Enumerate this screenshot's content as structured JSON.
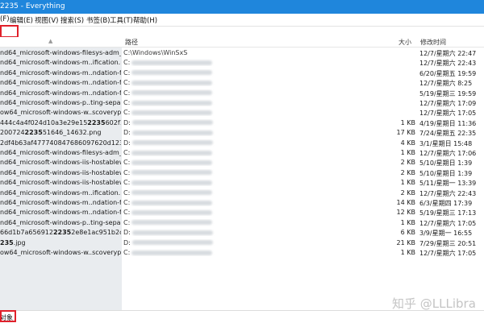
{
  "window": {
    "title": "2235 - Everything"
  },
  "menu": [
    "(F)",
    "编辑(E)",
    "视图(V)",
    "搜索(S)",
    "书签(B)",
    "工具(T)",
    "帮助(H)"
  ],
  "search": {
    "value": ""
  },
  "columns": {
    "name": "",
    "path": "路径",
    "size": "大小",
    "modified": "修改时间"
  },
  "rows": [
    {
      "name": "nd64_microsoft-windows-filesys-adm_31...",
      "path": "C:\\Windows\\WinSxS",
      "size": "",
      "modified": "12/7/星期六 22:47"
    },
    {
      "name": "nd64_microsoft-windows-m..ification.reso...",
      "path": "C:",
      "size": "",
      "modified": "12/7/星期六 22:43"
    },
    {
      "name": "nd64_microsoft-windows-m..ndation-fra...",
      "path": "C:",
      "size": "",
      "modified": "6/20/星期五 19:59"
    },
    {
      "name": "nd64_microsoft-windows-m..ndation-fra...",
      "path": "C:",
      "size": "",
      "modified": "12/7/星期六 8:25"
    },
    {
      "name": "nd64_microsoft-windows-m..ndation-fra...",
      "path": "C:",
      "size": "",
      "modified": "5/19/星期三 19:59"
    },
    {
      "name": "nd64_microsoft-windows-p..ting-separat...",
      "path": "C:",
      "size": "",
      "modified": "12/7/星期六 17:09"
    },
    {
      "name": "ow64_microsoft-windows-w..scoverypro...",
      "path": "C:",
      "size": "",
      "modified": "12/7/星期六 17:05"
    },
    {
      "name": "444c4a4f024d10a3e29e15",
      "bold": "2235",
      "tail": "602f180...",
      "path": "D:",
      "size": "1 KB",
      "modified": "4/19/星期日 11:36"
    },
    {
      "name": "200724",
      "bold": "2235",
      "tail": "51646_14632.png",
      "path": "D:",
      "size": "17 KB",
      "modified": "7/24/星期五 22:35"
    },
    {
      "name": "2df4b63af477740847686097620d1235...",
      "path": "D:",
      "size": "4 KB",
      "modified": "3/1/星期日 15:48"
    },
    {
      "name": "nd64_microsoft-windows-filesys-adm_31...",
      "path": "C:",
      "size": "1 KB",
      "modified": "12/7/星期六 17:06"
    },
    {
      "name": "nd64_microsoft-windows-iis-hostablewe...",
      "path": "C:",
      "size": "2 KB",
      "modified": "5/10/星期日 1:39"
    },
    {
      "name": "nd64_microsoft-windows-iis-hostablewe...",
      "path": "C:",
      "size": "2 KB",
      "modified": "5/10/星期日 1:39"
    },
    {
      "name": "nd64_microsoft-windows-iis-hostablewe...",
      "path": "C:",
      "size": "1 KB",
      "modified": "5/11/星期一 13:39"
    },
    {
      "name": "nd64_microsoft-windows-m..ification.reso...",
      "path": "C:",
      "size": "2 KB",
      "modified": "12/7/星期六 22:43"
    },
    {
      "name": "nd64_microsoft-windows-m..ndation-fra...",
      "path": "C:",
      "size": "14 KB",
      "modified": "6/3/星期四 17:39"
    },
    {
      "name": "nd64_microsoft-windows-m..ndation-fra...",
      "path": "C:",
      "size": "12 KB",
      "modified": "5/19/星期三 17:13"
    },
    {
      "name": "nd64_microsoft-windows-p..ting-separat...",
      "path": "C:",
      "size": "1 KB",
      "modified": "12/7/星期六 17:05"
    },
    {
      "name": "66d1b7a656912",
      "bold": "2235",
      "tail": "2e8e1ac951b2c63e...",
      "path": "D:",
      "size": "6 KB",
      "modified": "3/9/星期一 16:55"
    },
    {
      "name": "",
      "bold": "235",
      "tail": ".jpg",
      "path": "D:",
      "size": "21 KB",
      "modified": "7/29/星期三 20:51"
    },
    {
      "name": "ow64_microsoft-windows-w..scoverypro...",
      "path": "C:",
      "size": "1 KB",
      "modified": "12/7/星期六 17:05"
    }
  ],
  "status": {
    "text": "对象"
  },
  "watermark": "知乎 @LLLibra"
}
